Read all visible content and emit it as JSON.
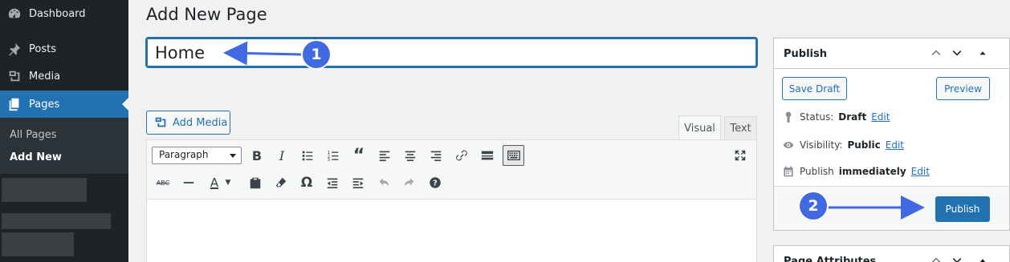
{
  "sidebar": {
    "items": [
      {
        "label": "Dashboard",
        "icon": "dashboard-icon"
      },
      {
        "label": "Posts",
        "icon": "pushpin-icon"
      },
      {
        "label": "Media",
        "icon": "media-icon"
      },
      {
        "label": "Pages",
        "icon": "pages-icon"
      }
    ],
    "submenu": [
      "All Pages",
      "Add New"
    ]
  },
  "page": {
    "title": "Add New Page",
    "title_value": "Home"
  },
  "editor": {
    "add_media_label": "Add Media",
    "tabs": [
      "Visual",
      "Text"
    ],
    "format_select": "Paragraph"
  },
  "publish": {
    "title": "Publish",
    "save_draft": "Save Draft",
    "preview": "Preview",
    "status_label": "Status:",
    "status_value": "Draft",
    "visibility_label": "Visibility:",
    "visibility_value": "Public",
    "publish_label": "Publish",
    "publish_value": "immediately",
    "edit_link": "Edit",
    "publish_button": "Publish"
  },
  "page_attributes": {
    "title": "Page Attributes"
  },
  "annotations": [
    "1",
    "2"
  ],
  "colors": {
    "accent": "#2271b1",
    "sidebar": "#1d2327",
    "callout": "#4169e1"
  }
}
